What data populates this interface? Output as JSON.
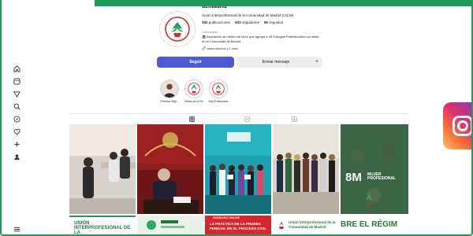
{
  "profile": {
    "username": "ucmadrid",
    "org_name": "Unión Interprofesional de la Comunidad de Madrid (UICM)",
    "stats": [
      {
        "value": "392",
        "label": "publicaciones"
      },
      {
        "value": "603",
        "label": "seguidores"
      },
      {
        "value": "96",
        "label": "seguidos"
      }
    ],
    "category": "Comunidad",
    "bio": "Asociación sin ánimo de lucro que agrupa a 35 Colegios Profesionales con sede en la Comunidad de Madrid.",
    "link": "www.uicm.es y 1 más"
  },
  "buttons": {
    "follow": "Seguir",
    "message": "Enviar mensaje",
    "suggest": "+"
  },
  "highlights": [
    {
      "label": "Premios Migr..."
    },
    {
      "label": "Retos de la Viv"
    },
    {
      "label": "Día Profesiones"
    }
  ],
  "tabs": [
    "posts-grid",
    "reels",
    "tagged"
  ],
  "posts": [
    {
      "caption": ""
    },
    {
      "caption": ""
    },
    {
      "caption": ""
    },
    {
      "caption": ""
    },
    {
      "caption": "8M",
      "subcaption": "MUJER PROFESIONAL"
    },
    {
      "caption": "UNIÓN INTERPROFESIONAL DE LA"
    },
    {
      "caption": ""
    },
    {
      "caption": "LA PRÁCTICA DE LA PRUEBA PERICIAL EN EL PROCESO CIVIL",
      "subcaption": "SEMINARIO ONLINE"
    },
    {
      "caption": "Unión Interprofesional de la Comunidad de Madrid"
    },
    {
      "caption": "BRE EL RÉGIM"
    }
  ],
  "colors": {
    "accent_green": "#1f9a5a",
    "follow_blue": "#4f5bd5"
  }
}
